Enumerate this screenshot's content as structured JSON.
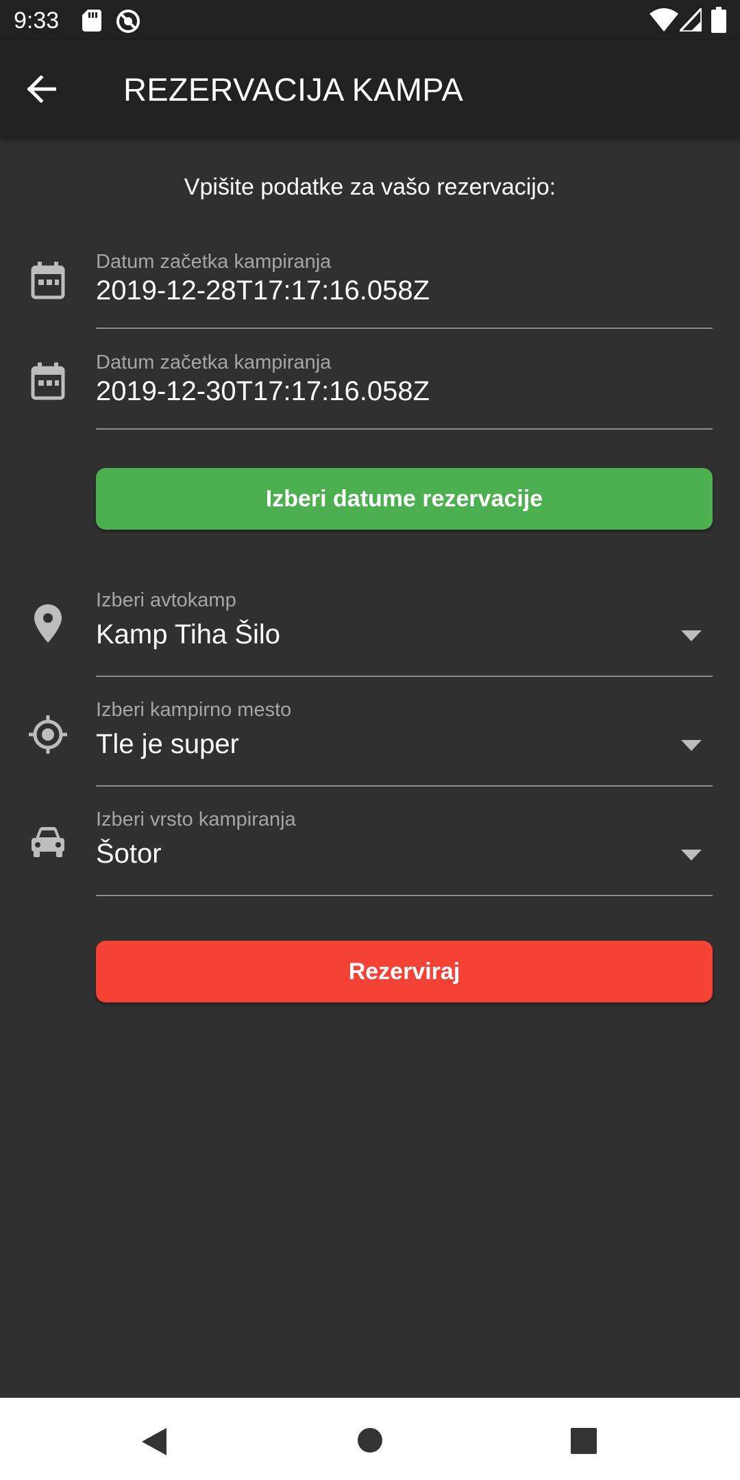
{
  "status_bar": {
    "time": "9:33",
    "icons": [
      "sd-card-icon",
      "sync-icon",
      "wifi-icon",
      "signal-icon",
      "battery-icon"
    ]
  },
  "app_bar": {
    "back_icon": "arrow-back-icon",
    "title": "REZERVACIJA KAMPA"
  },
  "form": {
    "intro": "Vpišite podatke za vašo rezervacijo:",
    "start_date": {
      "icon": "calendar-icon",
      "label": "Datum začetka kampiranja",
      "value": "2019-12-28T17:17:16.058Z"
    },
    "end_date": {
      "icon": "calendar-icon",
      "label": "Datum začetka kampiranja",
      "value": "2019-12-30T17:17:16.058Z"
    },
    "choose_dates_button": "Izberi datume rezervacije",
    "camp": {
      "icon": "location-pin-icon",
      "label": "Izberi avtokamp",
      "value": "Kamp Tiha Šilo"
    },
    "pitch": {
      "icon": "gps-target-icon",
      "label": "Izberi kampirno mesto",
      "value": "Tle je super"
    },
    "camping_type": {
      "icon": "car-icon",
      "label": "Izberi vrsto kampiranja",
      "value": "Šotor"
    },
    "reserve_button": "Rezerviraj"
  },
  "colors": {
    "background": "#303030",
    "app_bar": "#212121",
    "green_button": "#4caf50",
    "red_button": "#f44336"
  },
  "nav_bar": {
    "icons": [
      "nav-back-icon",
      "nav-home-icon",
      "nav-recents-icon"
    ]
  }
}
